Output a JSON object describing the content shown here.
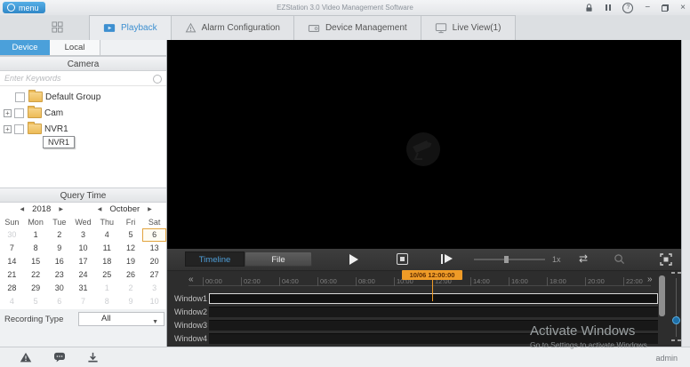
{
  "colors": {
    "accent_blue": "#3d8fd0",
    "device_tab_blue": "#4ba0da",
    "marker_orange": "#ef9b27",
    "selected_day_border": "#e2a43e",
    "panel_dark": "#2d2d2d"
  },
  "titlebar": {
    "menu_label": "menu",
    "title": "EZStation 3.0 Video Management Software"
  },
  "glyphs": {
    "minimize": "−",
    "close": "×",
    "help": "?",
    "cal_prev": "◀",
    "cal_next": "▶",
    "rewind": "«",
    "forward": "»",
    "dropdown": "▼",
    "sync": "⇄"
  },
  "tabs": [
    {
      "label": "Playback",
      "active": true
    },
    {
      "label": "Alarm Configuration",
      "active": false
    },
    {
      "label": "Device Management",
      "active": false
    },
    {
      "label": "Live View(1)",
      "active": false
    }
  ],
  "sidebar": {
    "tabs": [
      {
        "label": "Device",
        "active": true
      },
      {
        "label": "Local",
        "active": false
      }
    ],
    "panel_title": "Camera",
    "search_placeholder": "Enter Keywords",
    "tree": [
      {
        "label": "Default Group",
        "expandable": false
      },
      {
        "label": "Cam",
        "expandable": true
      },
      {
        "label": "NVR1",
        "expandable": true
      }
    ],
    "tooltip": "NVR1",
    "query_time_title": "Query Time",
    "calendar": {
      "year": "2018",
      "month": "October",
      "weekdays": [
        "Sun",
        "Mon",
        "Tue",
        "Wed",
        "Thu",
        "Fri",
        "Sat"
      ],
      "selected_day": "6",
      "weeks": [
        [
          {
            "d": "30",
            "muted": true
          },
          {
            "d": "1"
          },
          {
            "d": "2"
          },
          {
            "d": "3"
          },
          {
            "d": "4"
          },
          {
            "d": "5"
          },
          {
            "d": "6",
            "selected": true
          }
        ],
        [
          {
            "d": "7"
          },
          {
            "d": "8"
          },
          {
            "d": "9"
          },
          {
            "d": "10"
          },
          {
            "d": "11"
          },
          {
            "d": "12"
          },
          {
            "d": "13"
          }
        ],
        [
          {
            "d": "14"
          },
          {
            "d": "15"
          },
          {
            "d": "16"
          },
          {
            "d": "17"
          },
          {
            "d": "18"
          },
          {
            "d": "19"
          },
          {
            "d": "20"
          }
        ],
        [
          {
            "d": "21"
          },
          {
            "d": "22"
          },
          {
            "d": "23"
          },
          {
            "d": "24"
          },
          {
            "d": "25"
          },
          {
            "d": "26"
          },
          {
            "d": "27"
          }
        ],
        [
          {
            "d": "28"
          },
          {
            "d": "29"
          },
          {
            "d": "30"
          },
          {
            "d": "31"
          },
          {
            "d": "1",
            "muted": true
          },
          {
            "d": "2",
            "muted": true
          },
          {
            "d": "3",
            "muted": true
          }
        ],
        [
          {
            "d": "4",
            "muted": true
          },
          {
            "d": "5",
            "muted": true
          },
          {
            "d": "6",
            "muted": true
          },
          {
            "d": "7",
            "muted": true
          },
          {
            "d": "8",
            "muted": true
          },
          {
            "d": "9",
            "muted": true
          },
          {
            "d": "10",
            "muted": true
          }
        ]
      ]
    },
    "recording_type_label": "Recording Type",
    "recording_type_value": "All"
  },
  "playback": {
    "timeline_button": "Timeline",
    "file_button": "File",
    "speed_label": "1x",
    "ruler_ticks": [
      "00:00",
      "02:00",
      "04:00",
      "06:00",
      "08:00",
      "10:00",
      "12:00",
      "14:00",
      "16:00",
      "18:00",
      "20:00",
      "22:00"
    ],
    "marker_label": "10/06 12:00:00",
    "marker_tick_index": 6,
    "windows": [
      "Window1",
      "Window2",
      "Window3",
      "Window4"
    ]
  },
  "watermark": {
    "line1": "Activate Windows",
    "line2": "Go to Settings to activate Windows"
  },
  "statusbar": {
    "user": "admin"
  }
}
